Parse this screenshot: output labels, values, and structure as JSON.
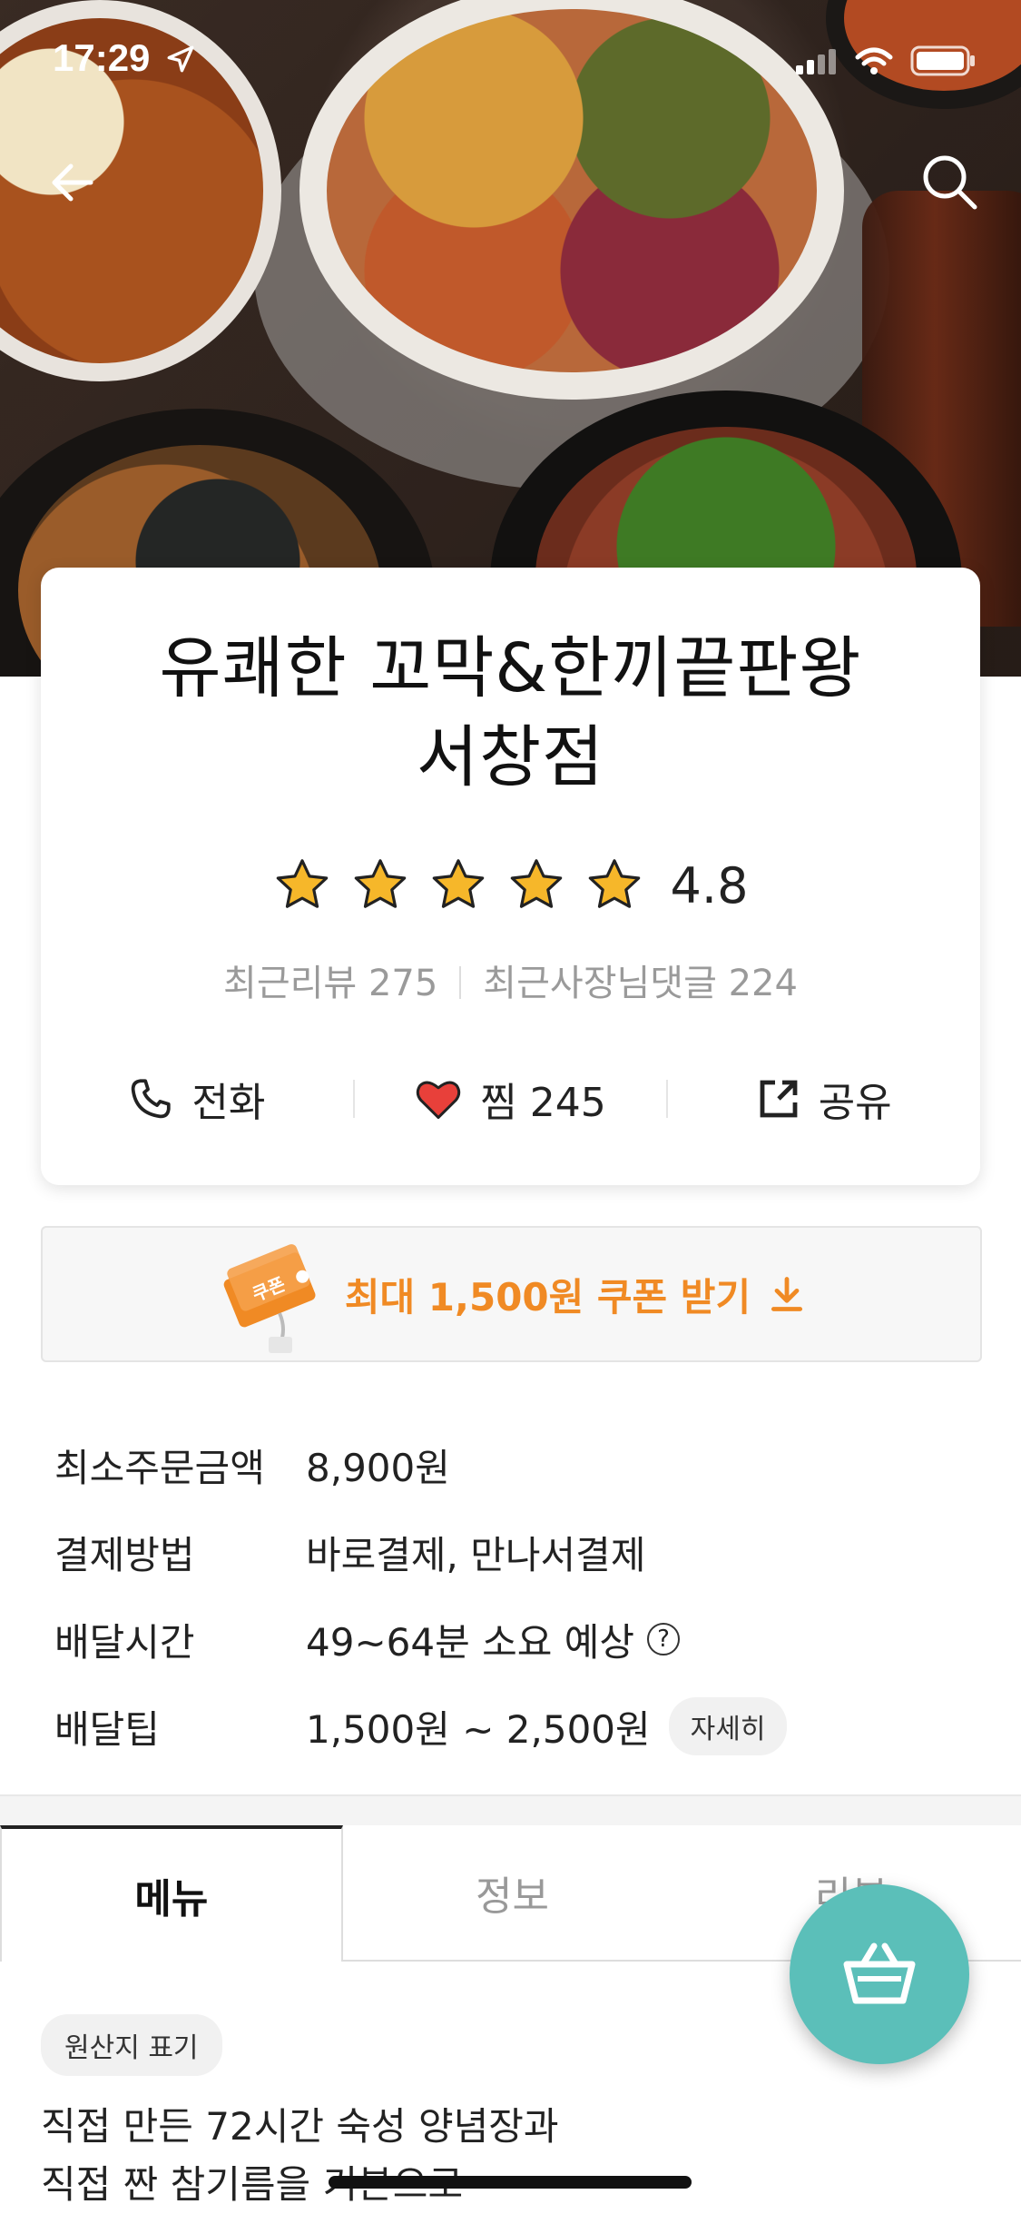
{
  "status_bar": {
    "time": "17:29"
  },
  "store": {
    "name_line1": "유쾌한 꼬막&한끼끝판왕",
    "name_line2": "서창점",
    "rating": "4.8",
    "recent_reviews_label": "최근리뷰 275",
    "owner_replies_label": "최근사장님댓글 224"
  },
  "actions": {
    "call": "전화",
    "like": "찜 245",
    "share": "공유"
  },
  "coupon": {
    "tag": "쿠폰",
    "text": "최대 1,500원 쿠폰 받기"
  },
  "info": [
    {
      "label": "최소주문금액",
      "value": "8,900원"
    },
    {
      "label": "결제방법",
      "value": "바로결제, 만나서결제"
    },
    {
      "label": "배달시간",
      "value": "49~64분 소요 예상"
    },
    {
      "label": "배달팁",
      "value": "1,500원 ~ 2,500원",
      "detail": "자세히"
    }
  ],
  "tabs": [
    "메뉴",
    "정보",
    "리뷰"
  ],
  "origin_badge": "원산지 표기",
  "description": {
    "line1": "직접 만든 72시간 숙성 양념장과",
    "line2": "직접 짠 참기름을 기본으로"
  },
  "colors": {
    "accent_orange": "#f08a24",
    "fab_teal": "#5bbfb9",
    "heart_red": "#e8403a",
    "star_gold": "#f6b72a"
  },
  "icons": [
    "back-arrow-icon",
    "search-icon",
    "star-icon",
    "phone-icon",
    "heart-icon",
    "share-icon",
    "download-icon",
    "question-icon",
    "cart-basket-icon"
  ]
}
